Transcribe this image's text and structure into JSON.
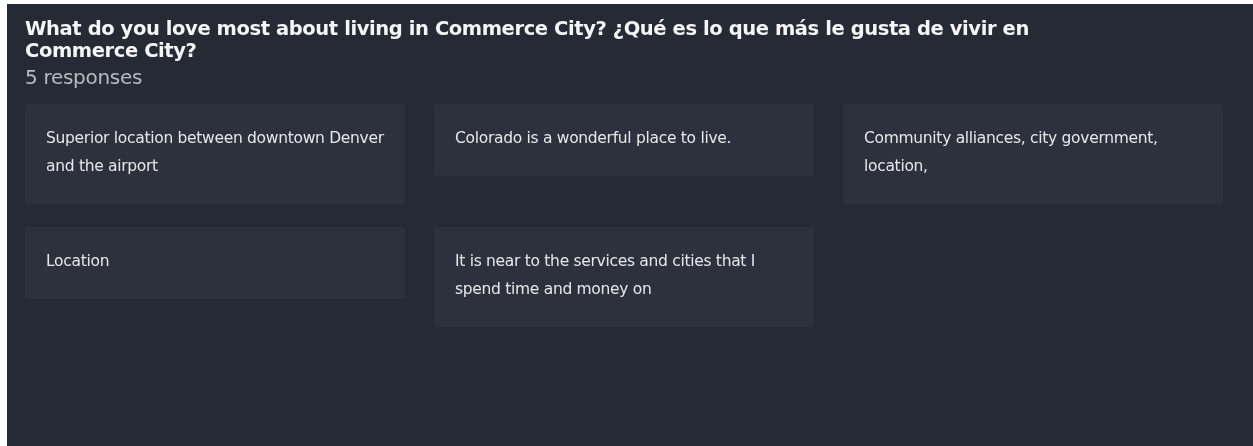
{
  "question": {
    "title": "What do you love most about living in Commerce City? ¿Qué es lo que más le gusta de vivir en Commerce City?",
    "count": "5 responses"
  },
  "responses": [
    {
      "text": "Superior location between downtown Denver and the airport"
    },
    {
      "text": "Colorado is a wonderful place to live."
    },
    {
      "text": "Community alliances, city government, location,"
    },
    {
      "text": "Location"
    },
    {
      "text": "It is near to the services and cities that I spend time and money on"
    }
  ]
}
